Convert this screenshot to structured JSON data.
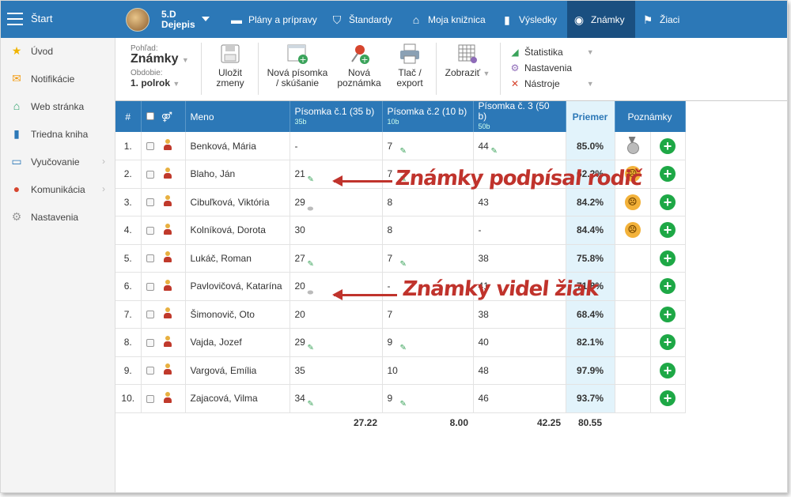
{
  "header": {
    "start_label": "Štart",
    "class_line1": "5.D",
    "class_line2": "Dejepis",
    "nav": [
      {
        "label": "Plány a prípravy",
        "icon": "briefcase-icon"
      },
      {
        "label": "Štandardy",
        "icon": "shield-icon"
      },
      {
        "label": "Moja knižnica",
        "icon": "library-icon"
      },
      {
        "label": "Výsledky",
        "icon": "bar-chart-icon"
      },
      {
        "label": "Známky",
        "icon": "grades-icon",
        "active": true
      },
      {
        "label": "Žiaci",
        "icon": "pupils-icon"
      }
    ]
  },
  "sidebar": {
    "items": [
      {
        "label": "Úvod",
        "icon": "star-icon"
      },
      {
        "label": "Notifikácie",
        "icon": "envelope-icon"
      },
      {
        "label": "Web stránka",
        "icon": "home-icon"
      },
      {
        "label": "Triedna kniha",
        "icon": "book-icon"
      },
      {
        "label": "Vyučovanie",
        "icon": "open-book-icon"
      },
      {
        "label": "Komunikácia",
        "icon": "chat-icon"
      },
      {
        "label": "Nastavenia",
        "icon": "gear-icon"
      }
    ]
  },
  "toolbar": {
    "view_label": "Pohľad:",
    "view_value": "Známky",
    "period_label": "Obdobie:",
    "period_value": "1. polrok",
    "save": "Uložit\nzmeny",
    "new_test": "Nová písomka\n/ skúšanie",
    "new_note": "Nová\npoznámka",
    "print": "Tlač /\nexport",
    "show": "Zobraziť",
    "stats": "Štatistika",
    "settings": "Nastavenia",
    "tools": "Nástroje"
  },
  "table": {
    "headers": {
      "num": "#",
      "name": "Meno",
      "test1": "Písomka č.1 (35 b)",
      "test1_pts": "35b",
      "test2": "Písomka č.2 (10 b)",
      "test2_pts": "10b",
      "test3": "Písomka č. 3 (50 b)",
      "test3_pts": "50b",
      "avg": "Priemer",
      "notes": "Poznámky"
    },
    "rows": [
      {
        "n": "1.",
        "name": "Benková, Mária",
        "t1": "-",
        "t2": "7",
        "t3": "44",
        "avg": "85.0%"
      },
      {
        "n": "2.",
        "name": "Blaho, Ján",
        "t1": "21",
        "t2": "7",
        "t3": "-",
        "avg": "62.2%"
      },
      {
        "n": "3.",
        "name": "Cibuľková, Viktória",
        "t1": "29",
        "t2": "8",
        "t3": "43",
        "avg": "84.2%"
      },
      {
        "n": "4.",
        "name": "Kolníková, Dorota",
        "t1": "30",
        "t2": "8",
        "t3": "-",
        "avg": "84.4%"
      },
      {
        "n": "5.",
        "name": "Lukáč, Roman",
        "t1": "27",
        "t2": "7",
        "t3": "38",
        "avg": "75.8%"
      },
      {
        "n": "6.",
        "name": "Pavlovičová, Katarína",
        "t1": "20",
        "t2": "-",
        "t3": "41",
        "avg": "71.8%"
      },
      {
        "n": "7.",
        "name": "Šimonovič, Oto",
        "t1": "20",
        "t2": "7",
        "t3": "38",
        "avg": "68.4%"
      },
      {
        "n": "8.",
        "name": "Vajda, Jozef",
        "t1": "29",
        "t2": "9",
        "t3": "40",
        "avg": "82.1%"
      },
      {
        "n": "9.",
        "name": "Vargová, Emília",
        "t1": "35",
        "t2": "10",
        "t3": "48",
        "avg": "97.9%"
      },
      {
        "n": "10.",
        "name": "Zajacová, Vilma",
        "t1": "34",
        "t2": "9",
        "t3": "46",
        "avg": "93.7%"
      }
    ],
    "totals": {
      "t1": "27.22",
      "t2": "8.00",
      "t3": "42.25",
      "avg": "80.55"
    }
  },
  "annotations": {
    "signed": "Známky podpísal rodič",
    "seen": "Známky videl žiak"
  },
  "colors": {
    "primary": "#2c78b7",
    "accent_red": "#c0332c",
    "add_green": "#1ea846"
  }
}
